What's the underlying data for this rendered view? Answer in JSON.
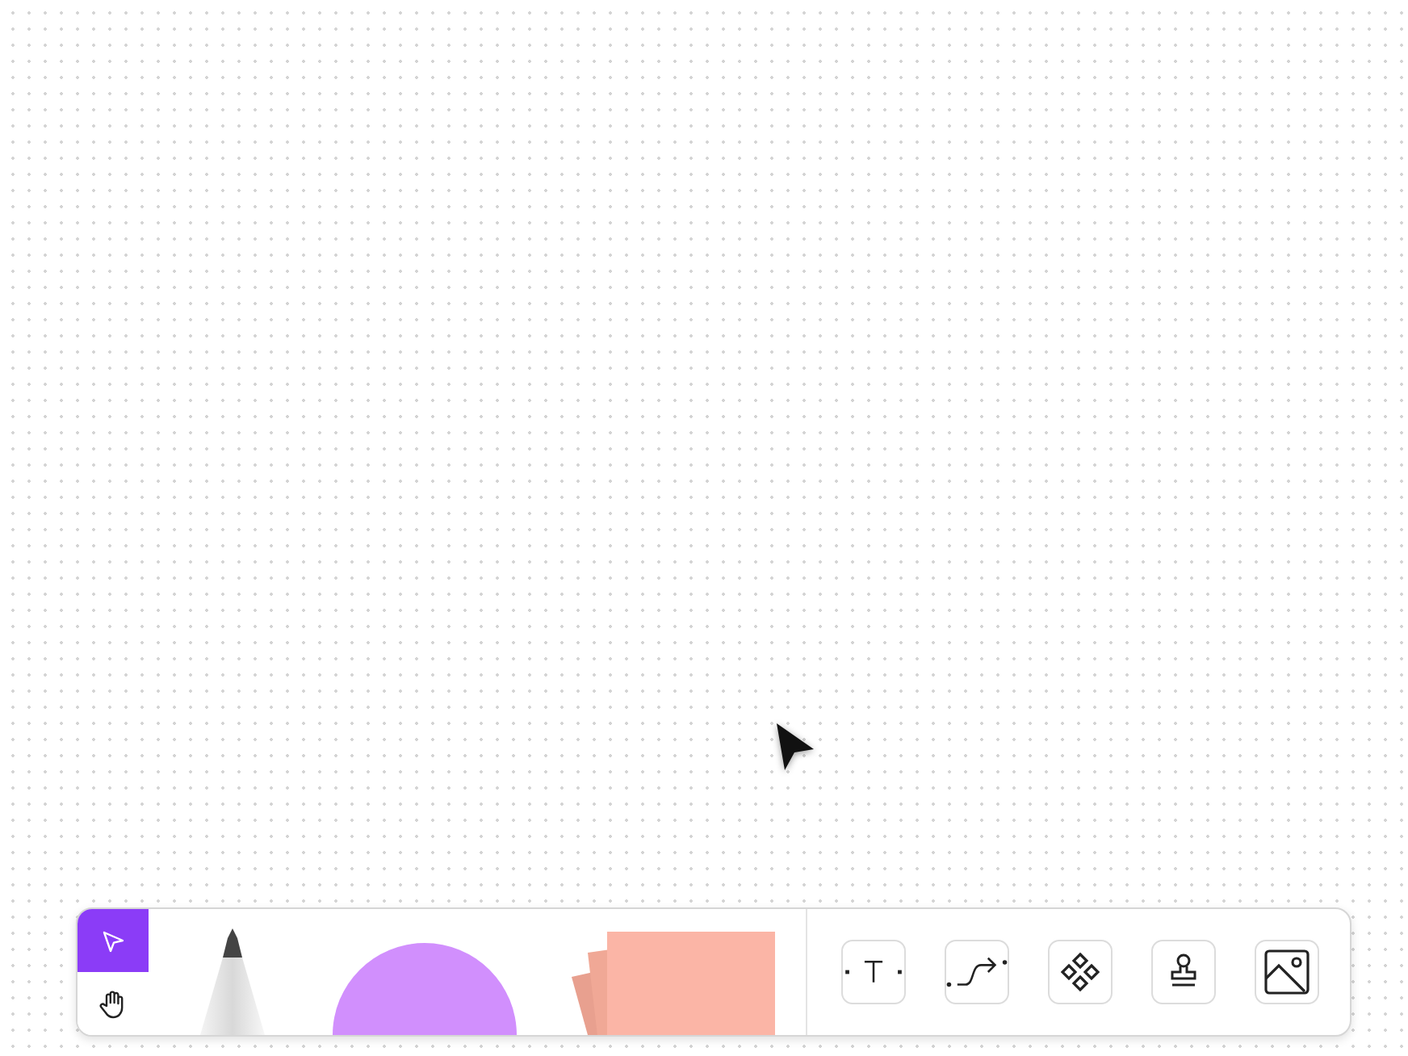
{
  "modes": [
    {
      "kind": "select",
      "selected": true
    },
    {
      "kind": "hand",
      "selected": false
    }
  ],
  "drawers": [
    {
      "kind": "pen"
    },
    {
      "kind": "shape"
    },
    {
      "kind": "sticky"
    }
  ],
  "tools": [
    {
      "kind": "text"
    },
    {
      "kind": "connector"
    },
    {
      "kind": "components"
    },
    {
      "kind": "stamp"
    },
    {
      "kind": "image"
    }
  ]
}
